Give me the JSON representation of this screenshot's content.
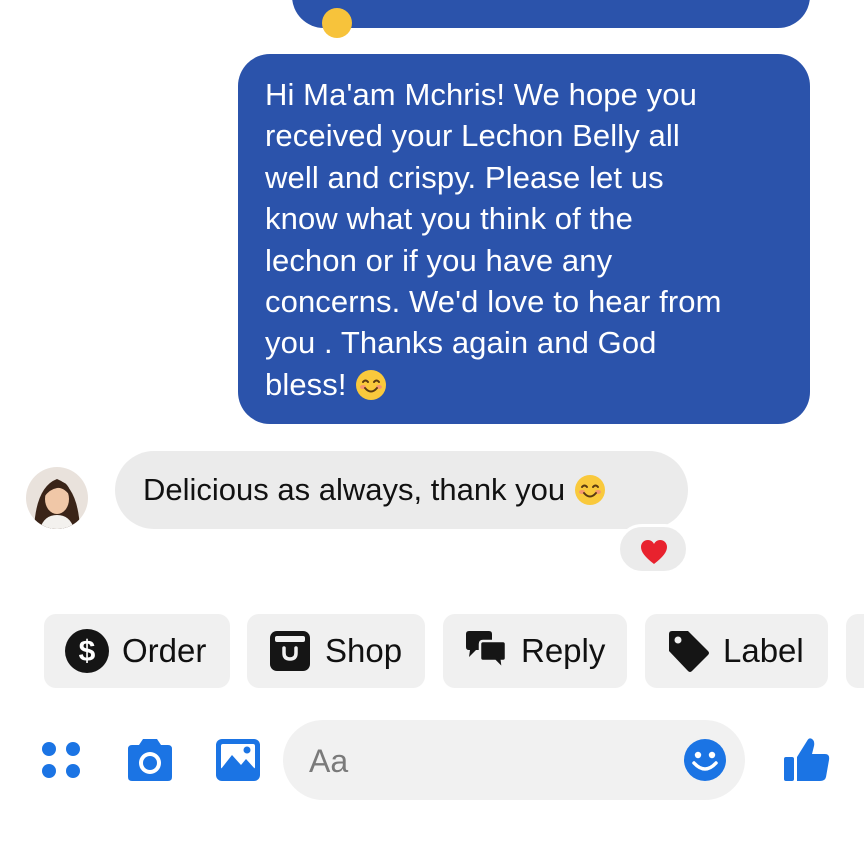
{
  "thread": {
    "outgoing_message": "Hi Ma'am Mchris! We hope you\nreceived your Lechon Belly all\nwell and crispy. Please let us\nknow what you think of the\nlechon or if you have any\nconcerns. We'd love to hear from\nyou . Thanks again and God\nbless!",
    "incoming_message": "Delicious as always, thank you",
    "reaction": "heart"
  },
  "quick_replies": {
    "order": "Order",
    "shop": "Shop",
    "reply": "Reply",
    "label": "Label"
  },
  "composer": {
    "placeholder": "Aa"
  },
  "colors": {
    "outgoing_bubble": "#2b53ab",
    "incoming_bubble": "#ebebeb",
    "accent": "#1b74e4",
    "reaction_heart": "#e8222e"
  },
  "icons": [
    "apps-icon",
    "camera-icon",
    "image-icon",
    "emoji-icon",
    "like-icon",
    "dollar-icon",
    "shop-icon",
    "reply-icon",
    "tag-icon",
    "smiling-emoji-icon",
    "heart-icon"
  ]
}
